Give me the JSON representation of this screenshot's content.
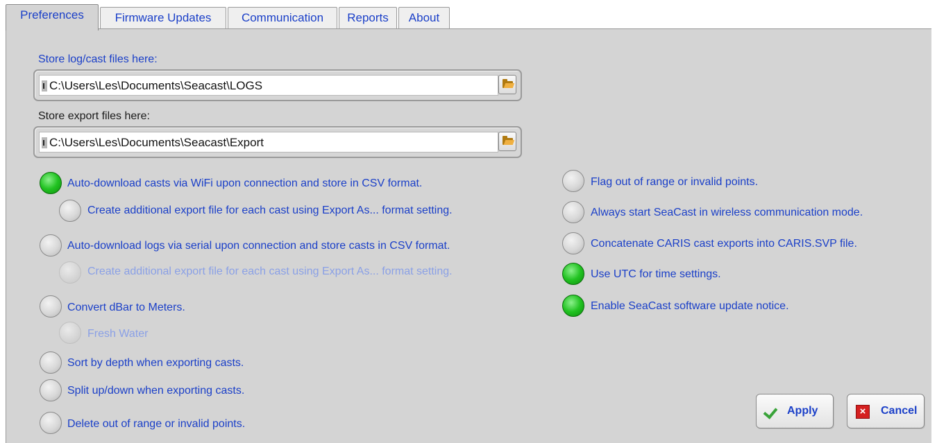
{
  "tabs": [
    {
      "label": "Preferences",
      "active": true
    },
    {
      "label": "Firmware Updates",
      "active": false
    },
    {
      "label": "Communication",
      "active": false
    },
    {
      "label": "Reports",
      "active": false
    },
    {
      "label": "About",
      "active": false
    }
  ],
  "preferences": {
    "log_path_label": "Store log/cast files here:",
    "log_path_value": "C:\\Users\\Les\\Documents\\Seacast\\LOGS",
    "export_path_label": "Store export files here:",
    "export_path_value": "C:\\Users\\Les\\Documents\\Seacast\\Export",
    "left_options": [
      {
        "label": "Auto-download casts via WiFi upon connection and store in CSV format.",
        "state": "on"
      },
      {
        "label": "Create additional export file for each cast using Export As... format setting.",
        "state": "off"
      },
      {
        "label": "Auto-download logs via serial upon connection and store casts in CSV format.",
        "state": "off"
      },
      {
        "label": "Create additional export file for each cast using  Export As... format setting.",
        "state": "disabled"
      },
      {
        "label": "Convert dBar to Meters.",
        "state": "off"
      },
      {
        "label": "Fresh Water",
        "state": "disabled"
      },
      {
        "label": "Sort by depth when exporting casts.",
        "state": "off"
      },
      {
        "label": "Split up/down when exporting casts.",
        "state": "off"
      },
      {
        "label": "Delete out of range or invalid points.",
        "state": "off"
      }
    ],
    "right_options": [
      {
        "label": "Flag out of range or invalid points.",
        "state": "off"
      },
      {
        "label": "Always start SeaCast in wireless communication mode.",
        "state": "off"
      },
      {
        "label": "Concatenate CARIS cast exports into CARIS.SVP file.",
        "state": "off"
      },
      {
        "label": "Use UTC for time settings.",
        "state": "on"
      },
      {
        "label": "Enable SeaCast software update notice.",
        "state": "on"
      }
    ]
  },
  "buttons": {
    "apply_label": "Apply",
    "cancel_label": "Cancel"
  },
  "icons": {
    "browse": "folder-open-icon",
    "apply": "checkmark-icon",
    "cancel": "red-x-icon"
  },
  "colors": {
    "label_blue": "#1a3fc8",
    "radio_on": "#22c322",
    "panel_bg": "#d4d4d4"
  }
}
